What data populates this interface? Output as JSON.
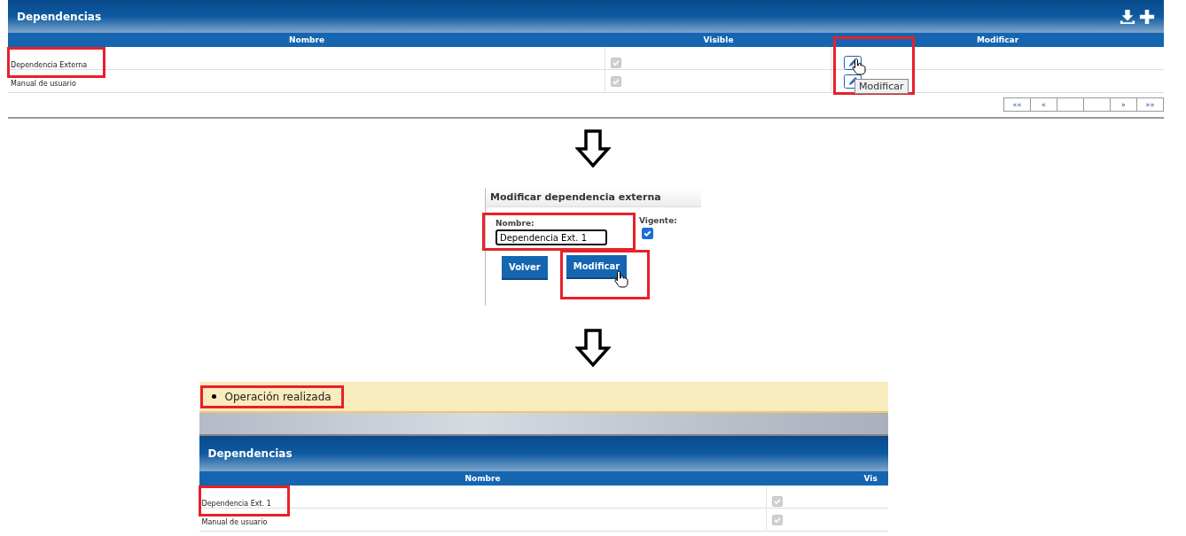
{
  "panel_top": {
    "title": "Dependencias",
    "columns": [
      "Nombre",
      "Visible",
      "Modificar"
    ],
    "rows": [
      {
        "name": "Dependencia Externa",
        "visible": true,
        "highlighted": true
      },
      {
        "name": "Manual de usuario",
        "visible": true,
        "highlighted": false
      }
    ],
    "tooltip": "Modificar",
    "pager": [
      "««",
      "«",
      "»",
      "»»"
    ]
  },
  "form": {
    "title": "Modificar dependencia externa",
    "name_label": "Nombre:",
    "name_value": "Dependencia Ext. 1",
    "vigente_label": "Vigente:",
    "vigente_checked": true,
    "buttons": [
      "Volver",
      "Modificar"
    ]
  },
  "message": {
    "text": "Operación realizada"
  },
  "panel_bottom": {
    "title": "Dependencias",
    "columns": [
      "Nombre",
      "Vis"
    ],
    "rows": [
      {
        "name": "Dependencia Ext. 1",
        "visible": true,
        "highlighted": true
      },
      {
        "name": "Manual de usuario",
        "visible": true,
        "highlighted": false
      }
    ]
  }
}
